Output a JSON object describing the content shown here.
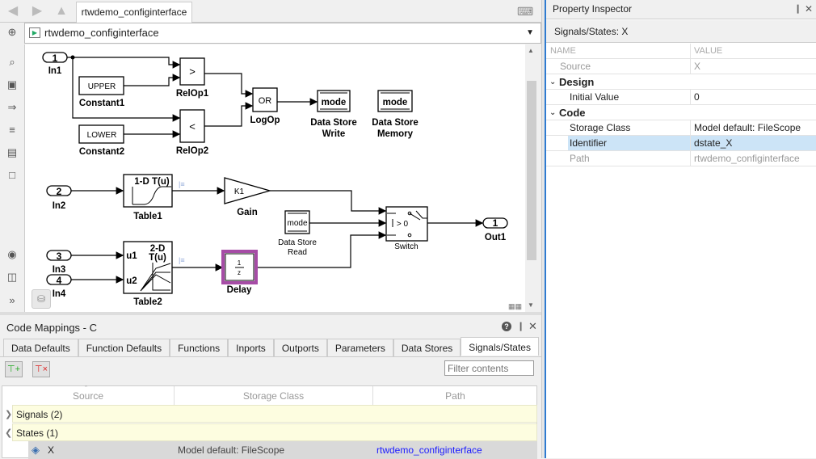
{
  "editor": {
    "tab": "rtwdemo_configinterface",
    "breadcrumb": "rtwdemo_configinterface"
  },
  "diagram": {
    "in1": {
      "num": "1",
      "label": "In1"
    },
    "in2": {
      "num": "2",
      "label": "In2"
    },
    "in3": {
      "num": "3",
      "label": "In3"
    },
    "in4": {
      "num": "4",
      "label": "In4"
    },
    "out1": {
      "num": "1",
      "label": "Out1"
    },
    "constant1": {
      "value": "UPPER",
      "label": "Constant1"
    },
    "constant2": {
      "value": "LOWER",
      "label": "Constant2"
    },
    "relop1": {
      "op": ">",
      "label": "RelOp1"
    },
    "relop2": {
      "op": "<",
      "label": "RelOp2"
    },
    "logop": {
      "op": "OR",
      "label": "LogOp"
    },
    "dsw": {
      "name": "mode",
      "label1": "Data Store",
      "label2": "Write"
    },
    "dsm": {
      "name": "mode",
      "label1": "Data Store",
      "label2": "Memory"
    },
    "dsr": {
      "name": "mode",
      "label1": "Data Store",
      "label2": "Read"
    },
    "table1": {
      "title": "1-D T(u)",
      "label": "Table1"
    },
    "table2": {
      "title1": "2-D",
      "title2": "T(u)",
      "u1": "u1",
      "u2": "u2",
      "label": "Table2"
    },
    "gain": {
      "value": "K1",
      "label": "Gain"
    },
    "delay": {
      "num": "1",
      "den": "z",
      "label": "Delay"
    },
    "switch": {
      "cond": "> 0",
      "label": "Switch"
    }
  },
  "code_mappings": {
    "title": "Code Mappings - C",
    "tabs": [
      "Data Defaults",
      "Function Defaults",
      "Functions",
      "Inports",
      "Outports",
      "Parameters",
      "Data Stores",
      "Signals/States"
    ],
    "active_tab": "Signals/States",
    "filter_placeholder": "Filter contents",
    "columns": [
      "Source",
      "Storage Class",
      "Path"
    ],
    "groups": [
      {
        "label": "Signals (2)",
        "expanded": false
      },
      {
        "label": "States (1)",
        "expanded": true
      }
    ],
    "rows": [
      {
        "source": "X",
        "storage_class": "Model default: FileScope",
        "path": "rtwdemo_configinterface"
      }
    ]
  },
  "property_inspector": {
    "title": "Property Inspector",
    "subtitle": "Signals/States: X",
    "col_name": "NAME",
    "col_value": "VALUE",
    "source": {
      "name": "Source",
      "value": "X"
    },
    "design": {
      "title": "Design",
      "initial_value": {
        "name": "Initial Value",
        "value": "0"
      }
    },
    "code": {
      "title": "Code",
      "storage_class": {
        "name": "Storage Class",
        "value": "Model default: FileScope"
      },
      "identifier": {
        "name": "Identifier",
        "value": "dstate_X"
      },
      "path": {
        "name": "Path",
        "value": "rtwdemo_configinterface"
      }
    }
  },
  "colors": {
    "selection": "#cce4f7",
    "group_bg": "#fdfde0",
    "delay_highlight": "#a64ca6",
    "link": "#1a1aff"
  }
}
